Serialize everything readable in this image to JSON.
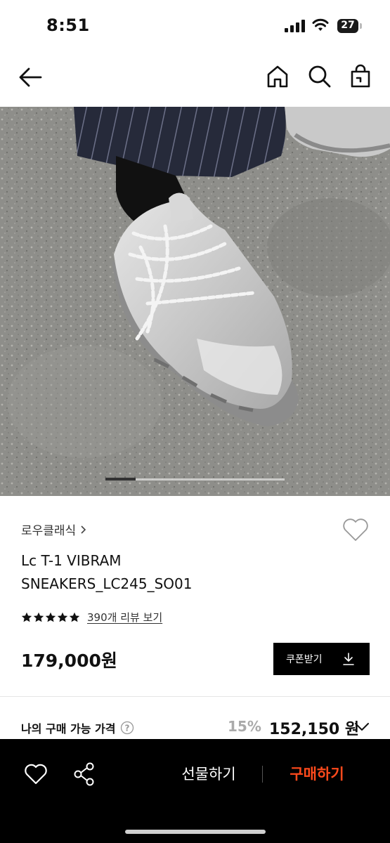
{
  "status_bar": {
    "time": "8:51",
    "battery": "27"
  },
  "header": {
    "icons": [
      "back-arrow-icon",
      "home-icon",
      "search-icon",
      "shopping-bag-icon"
    ]
  },
  "product": {
    "brand": "로우클래식",
    "name_line1": "Lc T-1 VIBRAM",
    "name_line2": "SNEAKERS_LC245_SO01",
    "rating": 5,
    "review_link": "390개 리뷰 보기",
    "price": "179,000원",
    "coupon_button": "쿠폰받기"
  },
  "my_price": {
    "label": "나의 구매 가능 가격",
    "discount": "15%",
    "final_price": "152,150 원"
  },
  "bottom_bar": {
    "gift_label": "선물하기",
    "buy_label": "구매하기",
    "buy_color": "#ff4a1c"
  },
  "image_carousel": {
    "current": 1,
    "total": 6
  }
}
